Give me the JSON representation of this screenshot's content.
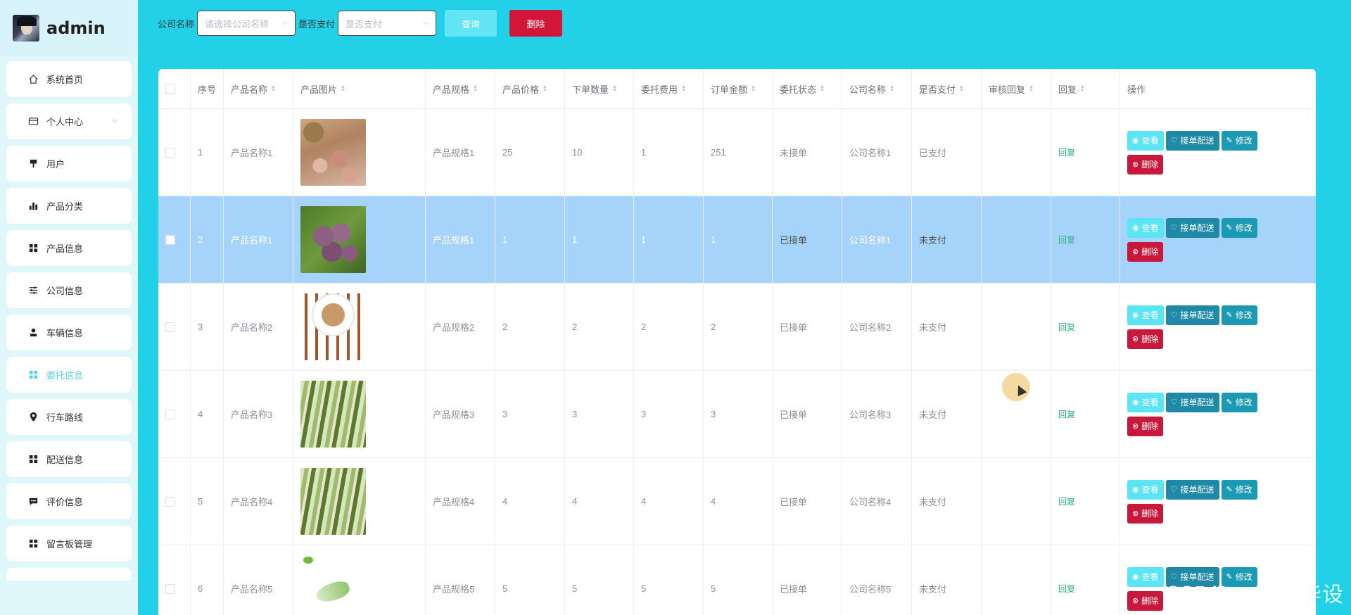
{
  "brand": {
    "name": "admin"
  },
  "sidebar": {
    "items": [
      {
        "label": "系统首页",
        "icon": "home-icon",
        "active": false
      },
      {
        "label": "个人中心",
        "icon": "card-icon",
        "active": false,
        "has_children": true
      },
      {
        "label": "用户",
        "icon": "user-flag-icon",
        "active": false
      },
      {
        "label": "产品分类",
        "icon": "bar-chart-icon",
        "active": false
      },
      {
        "label": "产品信息",
        "icon": "grid-icon",
        "active": false
      },
      {
        "label": "公司信息",
        "icon": "sliders-icon",
        "active": false
      },
      {
        "label": "车辆信息",
        "icon": "person-icon",
        "active": false
      },
      {
        "label": "委托信息",
        "icon": "grid-icon",
        "active": true
      },
      {
        "label": "行车路线",
        "icon": "location-pin-icon",
        "active": false
      },
      {
        "label": "配送信息",
        "icon": "grid-icon",
        "active": false
      },
      {
        "label": "评价信息",
        "icon": "chat-icon",
        "active": false
      },
      {
        "label": "留言板管理",
        "icon": "grid-icon",
        "active": false
      }
    ]
  },
  "search": {
    "company_label": "公司名称",
    "company_placeholder": "请选择公司名称",
    "paid_label": "是否支付",
    "paid_placeholder": "是否支付",
    "query_button": "查询",
    "delete_button": "删除"
  },
  "table": {
    "headers": [
      "序号",
      "产品名称",
      "产品图片",
      "产品规格",
      "产品价格",
      "下单数量",
      "委托费用",
      "订单金额",
      "委托状态",
      "公司名称",
      "是否支付",
      "审核回复",
      "回复",
      "操作"
    ],
    "rows": [
      {
        "index": "1",
        "product_name": "产品名称1",
        "image": "peanuts",
        "spec": "产品规格1",
        "price": "25",
        "qty": "10",
        "fee": "1",
        "amount": "251",
        "status": "未接单",
        "company": "公司名称1",
        "paid": "已支付",
        "review_reply": "",
        "reply": "回复",
        "selected": false
      },
      {
        "index": "2",
        "product_name": "产品名称1",
        "image": "grapes",
        "spec": "产品规格1",
        "price": "1",
        "qty": "1",
        "fee": "1",
        "amount": "1",
        "status": "已接单",
        "company": "公司名称1",
        "paid": "未支付",
        "review_reply": "",
        "reply": "回复",
        "selected": true
      },
      {
        "index": "3",
        "product_name": "产品名称2",
        "image": "dish",
        "spec": "产品规格2",
        "price": "2",
        "qty": "2",
        "fee": "2",
        "amount": "2",
        "status": "已接单",
        "company": "公司名称2",
        "paid": "未支付",
        "review_reply": "",
        "reply": "回复",
        "selected": false
      },
      {
        "index": "4",
        "product_name": "产品名称3",
        "image": "veg",
        "spec": "产品规格3",
        "price": "3",
        "qty": "3",
        "fee": "3",
        "amount": "3",
        "status": "已接单",
        "company": "公司名称3",
        "paid": "未支付",
        "review_reply": "",
        "reply": "回复",
        "selected": false
      },
      {
        "index": "5",
        "product_name": "产品名称4",
        "image": "veg",
        "spec": "产品规格4",
        "price": "4",
        "qty": "4",
        "fee": "4",
        "amount": "4",
        "status": "已接单",
        "company": "公司名称4",
        "paid": "未支付",
        "review_reply": "",
        "reply": "回复",
        "selected": false
      },
      {
        "index": "6",
        "product_name": "产品名称5",
        "image": "cabbage",
        "spec": "产品规格5",
        "price": "5",
        "qty": "5",
        "fee": "5",
        "amount": "5",
        "status": "已接单",
        "company": "公司名称5",
        "paid": "未支付",
        "review_reply": "",
        "reply": "回复",
        "selected": false
      }
    ],
    "actions": {
      "view": "查看",
      "dispatch": "接单配送",
      "edit": "修改",
      "delete": "删除"
    }
  },
  "watermark": "CSDN @米罗毕设",
  "colors": {
    "page_bg": "#22d1e8",
    "sidebar_bg": "#dff6fb",
    "accent": "#52d5e8",
    "danger": "#c8193d",
    "selected_row": "#a6d3f9",
    "reply_link": "#27b37a"
  }
}
